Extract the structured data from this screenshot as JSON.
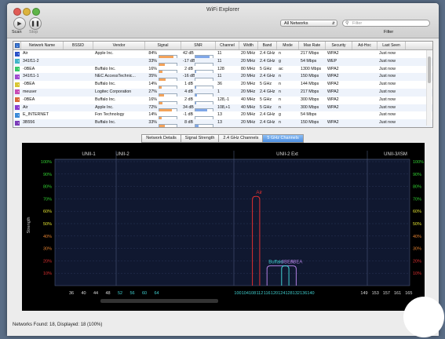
{
  "window": {
    "title": "WiFi Explorer"
  },
  "toolbar": {
    "scan_label": "Scan",
    "stop_label": "Stop",
    "filter_label": "Filter"
  },
  "network_select": {
    "value": "All Networks"
  },
  "filter": {
    "placeholder": "Filter"
  },
  "table": {
    "headers": [
      "",
      "Network Name",
      "BSSID",
      "Vendor",
      "Signal",
      "SNR",
      "Channel",
      "Width",
      "Band",
      "Mode",
      "Max Rate",
      "Security",
      "Ad-Hoc",
      "Last Seen"
    ],
    "rows": [
      {
        "color": "#2b52c8",
        "name": "Air",
        "bssid": "",
        "vendor": "Apple Inc.",
        "signal": 84,
        "signal_text": "84%",
        "snr": 42,
        "snr_text": "42 dB",
        "channel": "11",
        "width": "20 MHz",
        "band": "2.4 GHz",
        "mode": "n",
        "rate": "217 Mbps",
        "security": "WPA2",
        "adhoc": "",
        "seen": "Just now"
      },
      {
        "color": "#3fb4c8",
        "name": "341f11-2",
        "bssid": "",
        "vendor": "",
        "signal": 33,
        "signal_text": "33%",
        "snr": -17,
        "snr_text": "-17 dB",
        "channel": "11",
        "width": "20 MHz",
        "band": "2.4 GHz",
        "mode": "g",
        "rate": "54 Mbps",
        "security": "WEP",
        "adhoc": "",
        "seen": "Just now"
      },
      {
        "color": "#38c86a",
        "name": "-0BEA",
        "bssid": "",
        "vendor": "Buffalo Inc.",
        "signal": 16,
        "signal_text": "16%",
        "snr": 2,
        "snr_text": "2 dB",
        "channel": "128",
        "width": "80 MHz",
        "band": "5 GHz",
        "mode": "ac",
        "rate": "1300 Mbps",
        "security": "WPA2",
        "adhoc": "",
        "seen": "Just now"
      },
      {
        "color": "#a04ad0",
        "name": "341f11-1",
        "bssid": "",
        "vendor": "NEC AccessTechnic...",
        "signal": 35,
        "signal_text": "35%",
        "snr": -16,
        "snr_text": "-16 dB",
        "channel": "11",
        "width": "20 MHz",
        "band": "2.4 GHz",
        "mode": "n",
        "rate": "150 Mbps",
        "security": "WPA2",
        "adhoc": "",
        "seen": "Just now"
      },
      {
        "color": "#d8c632",
        "name": "-0BEA",
        "bssid": "",
        "vendor": "Buffalo Inc.",
        "signal": 14,
        "signal_text": "14%",
        "snr": 1,
        "snr_text": "1 dB",
        "channel": "36",
        "width": "20 MHz",
        "band": "5 GHz",
        "mode": "n",
        "rate": "144 Mbps",
        "security": "WPA2",
        "adhoc": "",
        "seen": "Just now"
      },
      {
        "color": "#c84ab4",
        "name": "meuser",
        "bssid": "",
        "vendor": "Logitec Corporation",
        "signal": 27,
        "signal_text": "27%",
        "snr": 4,
        "snr_text": "4 dB",
        "channel": "1",
        "width": "20 MHz",
        "band": "2.4 GHz",
        "mode": "n",
        "rate": "217 Mbps",
        "security": "WPA2",
        "adhoc": "",
        "seen": "Just now"
      },
      {
        "color": "#d86a38",
        "name": "-0BEA",
        "bssid": "",
        "vendor": "Buffalo Inc.",
        "signal": 16,
        "signal_text": "16%",
        "snr": 2,
        "snr_text": "2 dB",
        "channel": "128,-1",
        "width": "40 MHz",
        "band": "5 GHz",
        "mode": "n",
        "rate": "300 Mbps",
        "security": "WPA2",
        "adhoc": "",
        "seen": "Just now"
      },
      {
        "color": "#8a3ad0",
        "name": "Air",
        "bssid": "",
        "vendor": "Apple Inc.",
        "signal": 72,
        "signal_text": "72%",
        "snr": 34,
        "snr_text": "34 dB",
        "channel": "108,+1",
        "width": "40 MHz",
        "band": "5 GHz",
        "mode": "n",
        "rate": "300 Mbps",
        "security": "WPA2",
        "adhoc": "",
        "seen": "Just now"
      },
      {
        "color": "#3a8ad8",
        "name": "E_INTERNET",
        "bssid": "",
        "vendor": "Fon Technology",
        "signal": 14,
        "signal_text": "14%",
        "snr": -1,
        "snr_text": "-1 dB",
        "channel": "13",
        "width": "20 MHz",
        "band": "2.4 GHz",
        "mode": "g",
        "rate": "54 Mbps",
        "security": "",
        "adhoc": "",
        "seen": "Just now"
      },
      {
        "color": "#7a3ab8",
        "name": "3B556",
        "bssid": "",
        "vendor": "Buffalo Inc.",
        "signal": 33,
        "signal_text": "33%",
        "snr": 8,
        "snr_text": "8 dB",
        "channel": "13",
        "width": "20 MHz",
        "band": "2.4 GHz",
        "mode": "n",
        "rate": "150 Mbps",
        "security": "WPA2",
        "adhoc": "",
        "seen": "Just now"
      }
    ]
  },
  "tabs": [
    {
      "label": "Network Details"
    },
    {
      "label": "Signal Strength"
    },
    {
      "label": "2.4 GHz Channels"
    },
    {
      "label": "5 GHz Channels"
    }
  ],
  "graph": {
    "bands": [
      "UNII-1",
      "UNII-2",
      "UNII-2 Ext",
      "UNII-3/ISM"
    ],
    "ylabel": "Strength",
    "y_ticks": [
      "100%",
      "90%",
      "80%",
      "70%",
      "60%",
      "50%",
      "40%",
      "30%",
      "20%",
      "10%"
    ],
    "y_colors": [
      "#32d232",
      "#32d232",
      "#32d232",
      "#32d232",
      "#e0e030",
      "#e0e030",
      "#e08030",
      "#e08030",
      "#e03030",
      "#e03030"
    ],
    "channels_low": [
      "36",
      "40",
      "44",
      "48",
      "52",
      "56",
      "60",
      "64"
    ],
    "channels_mid": [
      "100",
      "104",
      "108",
      "112",
      "116",
      "120",
      "124",
      "128",
      "132",
      "136",
      "140"
    ],
    "channels_high": [
      "149",
      "153",
      "157",
      "161",
      "165"
    ],
    "labels": {
      "air": "Air",
      "buffalo_a": "Buffalo",
      "buffalo_b": "-0BEA",
      "buffalo_c": "0BEA"
    }
  },
  "chart_data": {
    "type": "area",
    "title": "",
    "xlabel": "",
    "ylabel": "Strength",
    "ylim": [
      0,
      100
    ],
    "series": [
      {
        "name": "Air",
        "channel": "108,+1",
        "channels": [
          108,
          112
        ],
        "values": [
          72
        ],
        "color": "#e03030"
      },
      {
        "name": "-0BEA",
        "channel": "128",
        "channels": [
          116,
          132
        ],
        "values": [
          16
        ],
        "color": "#b080e0"
      },
      {
        "name": "-0BEA",
        "channel": "128,-1",
        "channels": [
          124,
          128
        ],
        "values": [
          16
        ],
        "color": "#40d0d0"
      }
    ]
  },
  "status": {
    "text": "Networks Found: 18, Displayed: 18 (100%)"
  }
}
